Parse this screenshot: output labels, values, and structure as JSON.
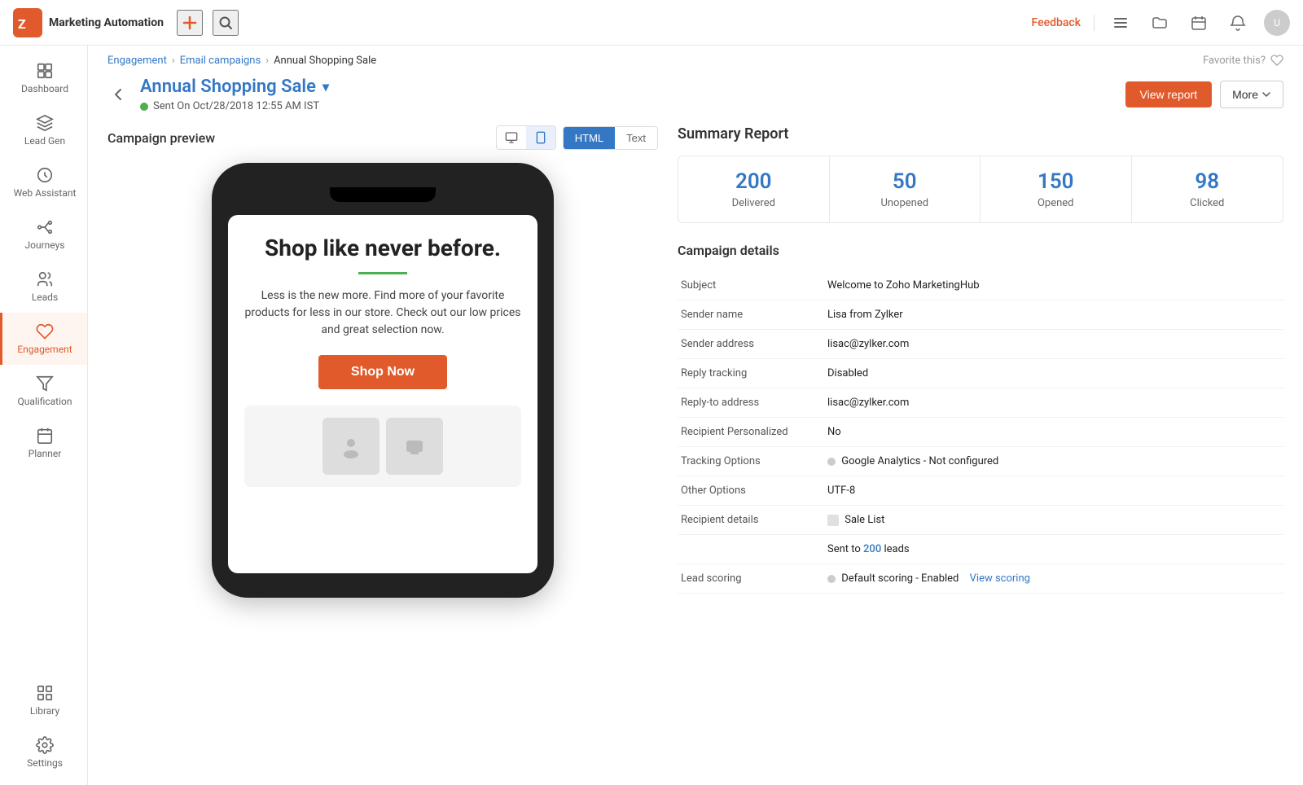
{
  "app": {
    "name": "Marketing Automation",
    "logo_text": "ZOHO"
  },
  "topbar": {
    "feedback_label": "Feedback",
    "add_icon": "+",
    "search_icon": "🔍",
    "avatar_initials": "U"
  },
  "breadcrumb": {
    "items": [
      "Engagement",
      "Email campaigns",
      "Annual Shopping Sale"
    ]
  },
  "page": {
    "title": "Annual Shopping Sale",
    "sent_status": "Sent On Oct/28/2018 12:55 AM IST",
    "view_report_label": "View report",
    "more_label": "More",
    "favorite_label": "Favorite this?"
  },
  "preview": {
    "title": "Campaign preview",
    "toggle": {
      "desktop_label": "Desktop",
      "mobile_label": "Mobile",
      "html_label": "HTML",
      "text_label": "Text"
    },
    "email": {
      "headline": "Shop like never before.",
      "body": "Less is the new more. Find more of your favorite products for less in our store. Check out our low prices and great selection now.",
      "cta_label": "Shop Now"
    }
  },
  "summary": {
    "title": "Summary Report",
    "stats": [
      {
        "num": "200",
        "label": "Delivered"
      },
      {
        "num": "50",
        "label": "Unopened"
      },
      {
        "num": "150",
        "label": "Opened"
      },
      {
        "num": "98",
        "label": "Clicked"
      }
    ]
  },
  "campaign_details": {
    "title": "Campaign details",
    "rows": [
      {
        "key": "Subject",
        "val": "Welcome to Zoho MarketingHub"
      },
      {
        "key": "Sender name",
        "val": "Lisa from Zylker"
      },
      {
        "key": "Sender address",
        "val": "lisac@zylker.com"
      },
      {
        "key": "Reply tracking",
        "val": "Disabled"
      },
      {
        "key": "Reply-to address",
        "val": "lisac@zylker.com"
      },
      {
        "key": "Recipient Personalized",
        "val": "No"
      },
      {
        "key": "Tracking Options",
        "val": "Google Analytics - Not configured",
        "has_dot": true
      },
      {
        "key": "Other Options",
        "val": "UTF-8"
      },
      {
        "key": "Recipient details",
        "val": "Sale List",
        "has_icon": true
      },
      {
        "key": "",
        "val_parts": [
          "Sent to ",
          "200",
          " leads"
        ],
        "is_sent": true
      },
      {
        "key": "Lead scoring",
        "val": "Default scoring - Enabled",
        "has_dot": true,
        "extra_link": "View scoring"
      }
    ]
  },
  "sidebar": {
    "items": [
      {
        "id": "dashboard",
        "label": "Dashboard",
        "icon": "dashboard"
      },
      {
        "id": "lead-gen",
        "label": "Lead Gen",
        "icon": "lead-gen"
      },
      {
        "id": "web-assistant",
        "label": "Web Assistant",
        "icon": "web-assistant"
      },
      {
        "id": "journeys",
        "label": "Journeys",
        "icon": "journeys"
      },
      {
        "id": "leads",
        "label": "Leads",
        "icon": "leads"
      },
      {
        "id": "engagement",
        "label": "Engagement",
        "icon": "engagement",
        "active": true
      },
      {
        "id": "qualification",
        "label": "Qualification",
        "icon": "qualification"
      },
      {
        "id": "planner",
        "label": "Planner",
        "icon": "planner"
      },
      {
        "id": "library",
        "label": "Library",
        "icon": "library"
      },
      {
        "id": "settings",
        "label": "Settings",
        "icon": "settings"
      }
    ]
  }
}
